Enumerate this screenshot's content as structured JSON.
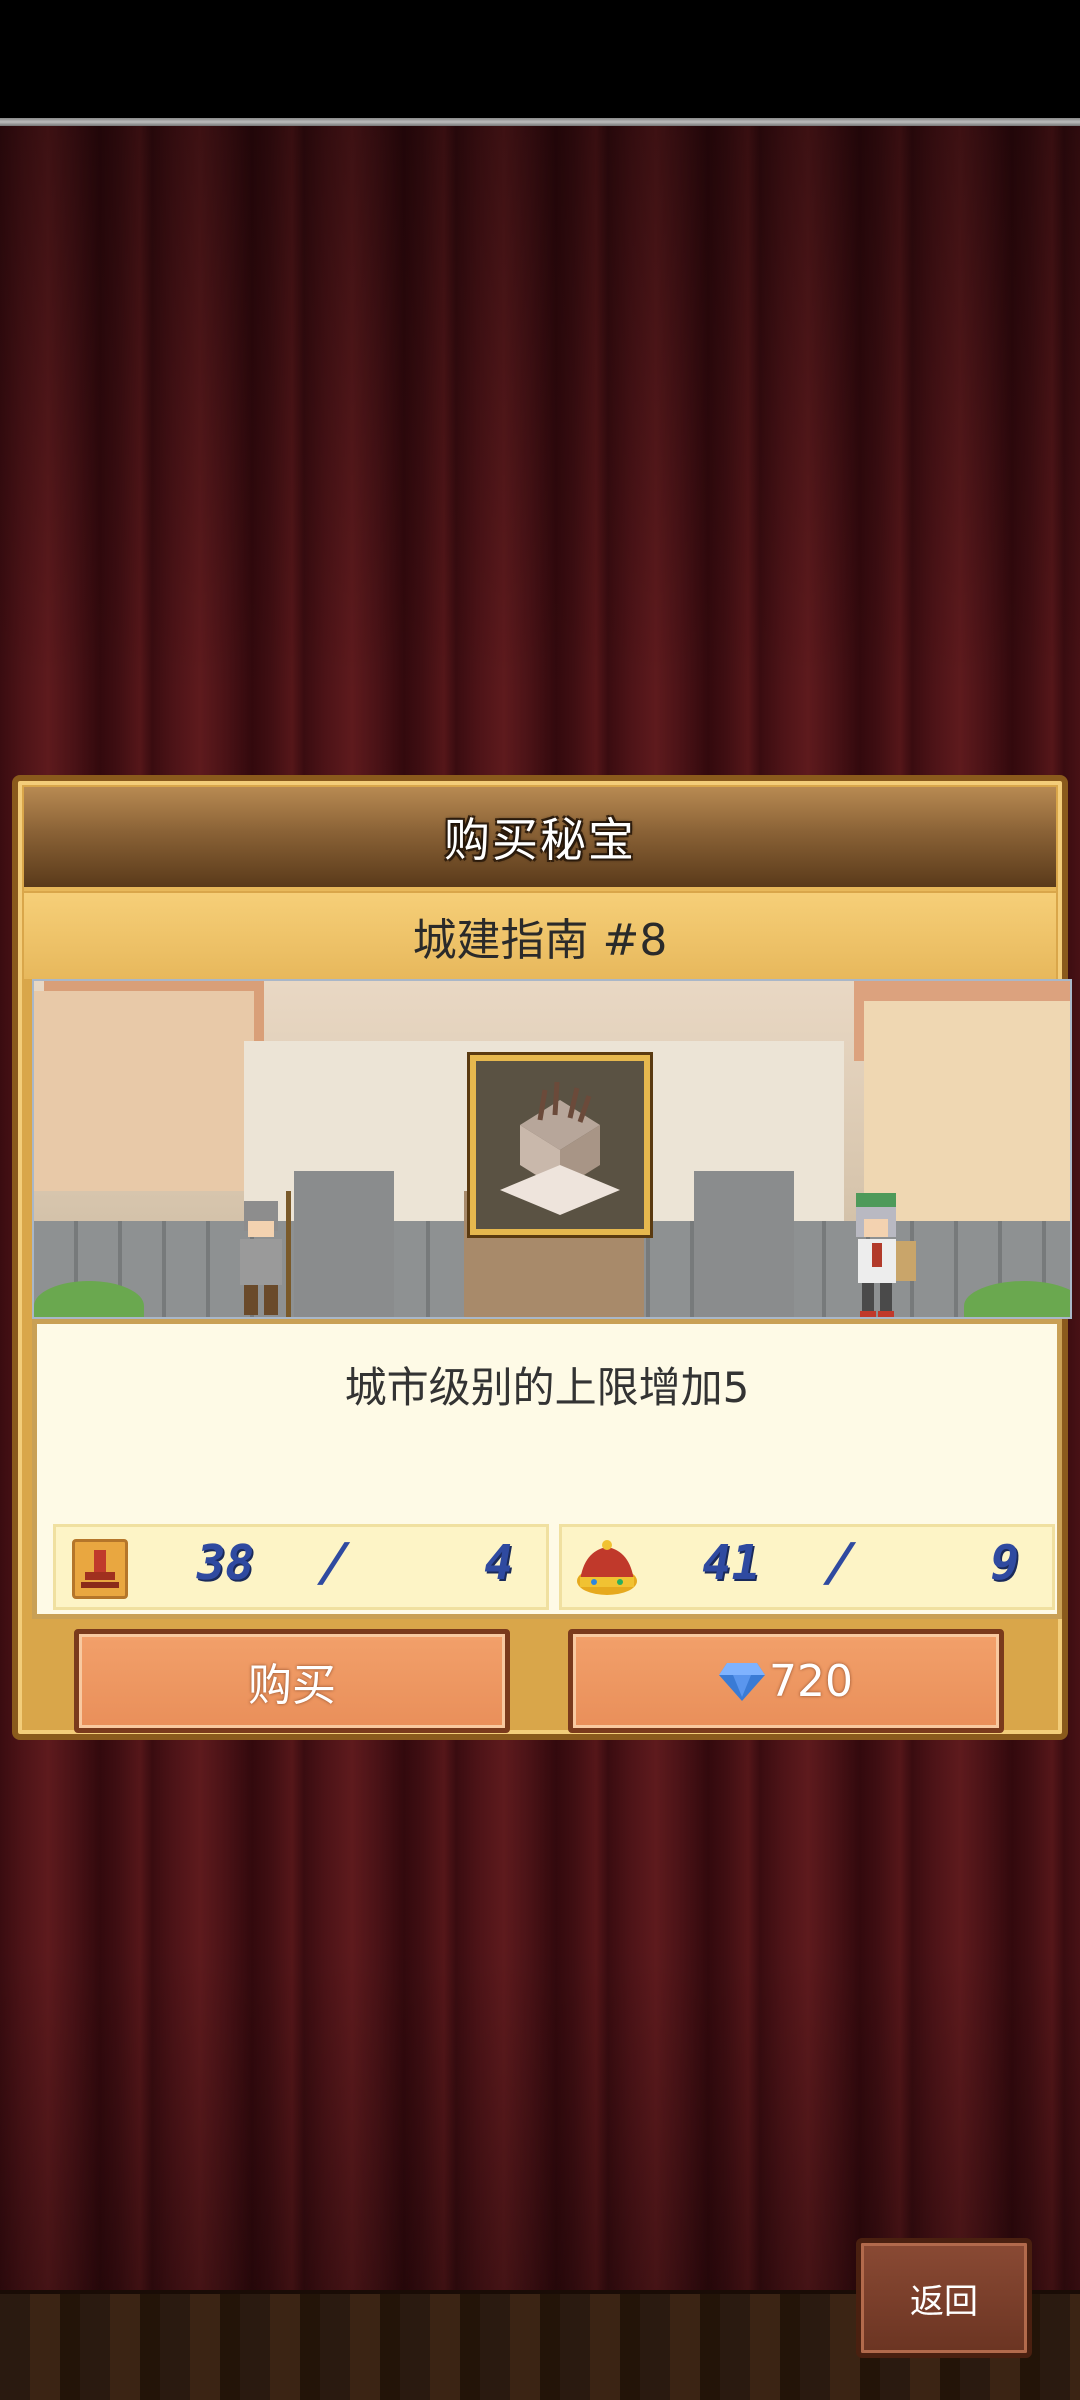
{
  "dialog": {
    "title": "购买秘宝",
    "item_name": "城建指南 #8",
    "description": "城市级别的上限增加5",
    "stats": {
      "left": {
        "icon": "trophy-icon",
        "current": "38",
        "separator": "/",
        "required": "4"
      },
      "right": {
        "icon": "crown-icon",
        "current": "41",
        "separator": "/",
        "required": "9"
      }
    },
    "buy_label": "购买",
    "gem_price": "720",
    "gem_icon": "diamond-icon"
  },
  "back_label": "返回",
  "colors": {
    "button_orange": "#e98f5a",
    "panel_cream": "#fefae6",
    "header_brown": "#8a6236",
    "number_blue": "#2f4aa0"
  }
}
